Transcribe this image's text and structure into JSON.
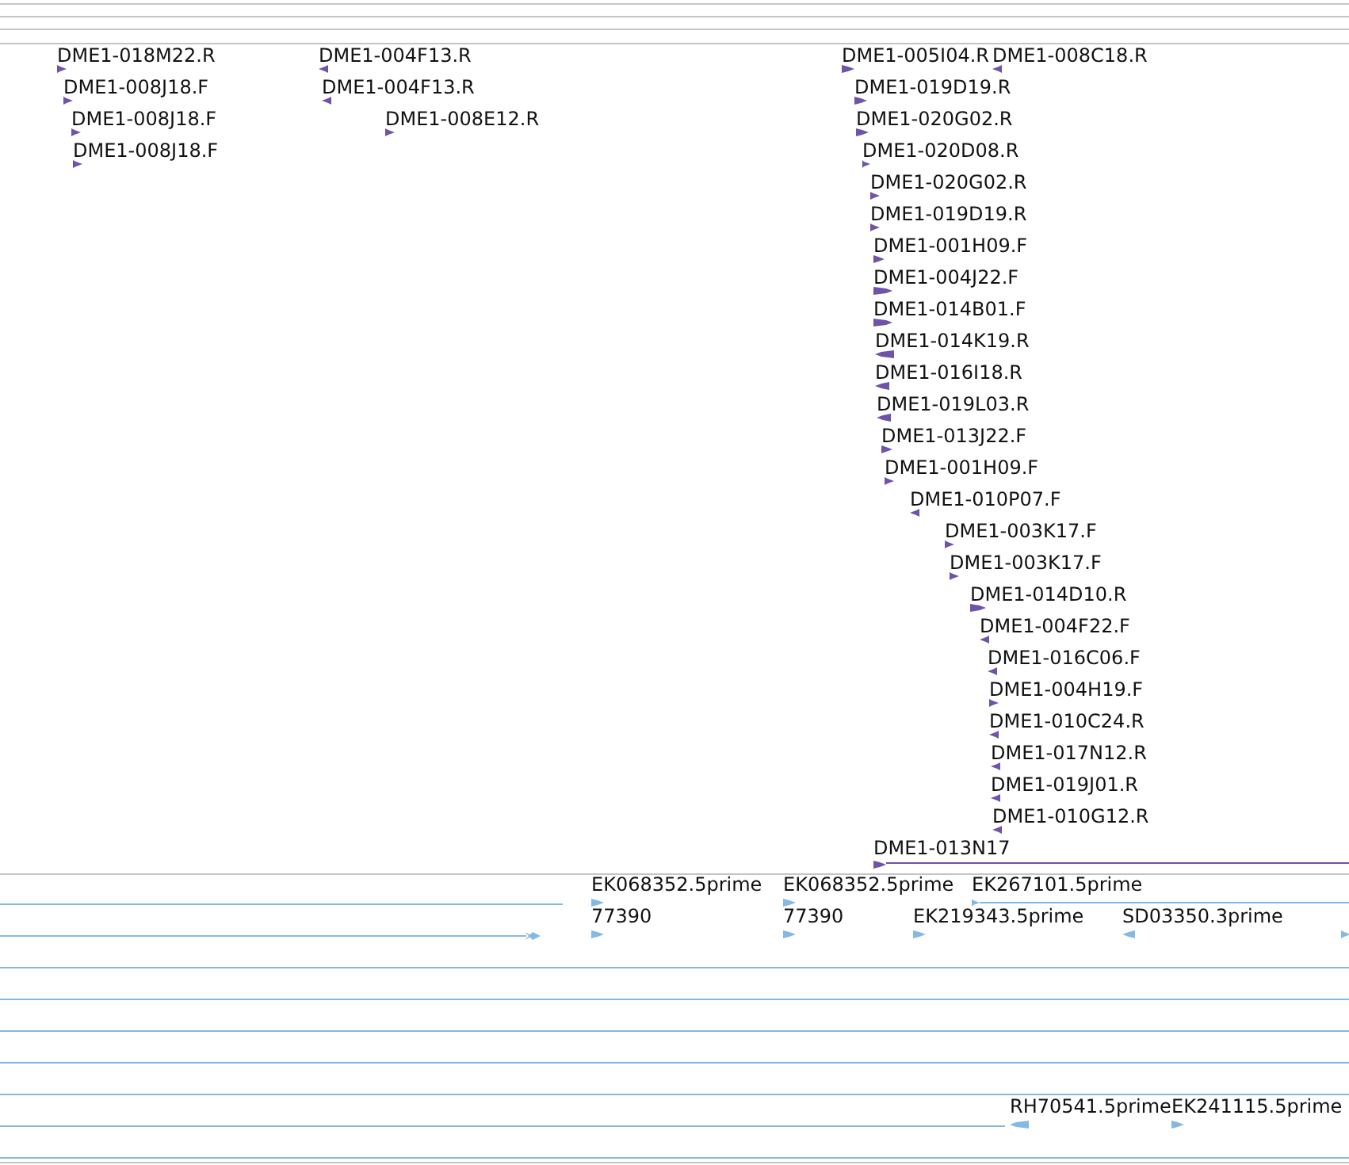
{
  "tracks": [
    {
      "kind": "clones",
      "features": [
        {
          "label": "DME1-018M22.R",
          "kind": "forward"
        },
        {
          "label": "DME1-008J18.F",
          "kind": "forward"
        },
        {
          "label": "DME1-008J18.F",
          "kind": "forward"
        },
        {
          "label": "DME1-008J18.F",
          "kind": "forward"
        },
        {
          "label": "DME1-004F13.R",
          "kind": "reverse"
        },
        {
          "label": "DME1-004F13.R",
          "kind": "reverse"
        },
        {
          "label": "DME1-008E12.R",
          "kind": "forward"
        },
        {
          "label": "DME1-005I04.R",
          "kind": "forward"
        },
        {
          "label": "DME1-008C18.R",
          "kind": "reverse"
        },
        {
          "label": "DME1-019D19.R",
          "kind": "forward"
        },
        {
          "label": "DME1-020G02.R",
          "kind": "forward"
        },
        {
          "label": "DME1-020D08.R",
          "kind": "forward"
        },
        {
          "label": "DME1-020G02.R",
          "kind": "forward"
        },
        {
          "label": "DME1-019D19.R",
          "kind": "forward"
        },
        {
          "label": "DME1-001H09.F",
          "kind": "forward"
        },
        {
          "label": "DME1-004J22.F",
          "kind": "forward"
        },
        {
          "label": "DME1-014B01.F",
          "kind": "forward"
        },
        {
          "label": "DME1-014K19.R",
          "kind": "reverse"
        },
        {
          "label": "DME1-016I18.R",
          "kind": "reverse"
        },
        {
          "label": "DME1-019L03.R",
          "kind": "reverse"
        },
        {
          "label": "DME1-013J22.F",
          "kind": "forward"
        },
        {
          "label": "DME1-001H09.F",
          "kind": "forward"
        },
        {
          "label": "DME1-010P07.F",
          "kind": "reverse"
        },
        {
          "label": "DME1-003K17.F",
          "kind": "forward"
        },
        {
          "label": "DME1-003K17.F",
          "kind": "forward"
        },
        {
          "label": "DME1-014D10.R",
          "kind": "forward"
        },
        {
          "label": "DME1-004F22.F",
          "kind": "reverse"
        },
        {
          "label": "DME1-016C06.F",
          "kind": "reverse"
        },
        {
          "label": "DME1-004H19.F",
          "kind": "forward"
        },
        {
          "label": "DME1-010C24.R",
          "kind": "reverse"
        },
        {
          "label": "DME1-017N12.R",
          "kind": "reverse"
        },
        {
          "label": "DME1-019J01.R",
          "kind": "reverse"
        },
        {
          "label": "DME1-010G12.R",
          "kind": "reverse"
        },
        {
          "label": "DME1-013N17",
          "kind": "forward"
        }
      ]
    },
    {
      "kind": "ests",
      "features": [
        {
          "label": "EK068352.5prime",
          "kind": "forward"
        },
        {
          "label": "EK068352.5prime",
          "kind": "forward"
        },
        {
          "label": "EK267101.5prime",
          "kind": "forward"
        },
        {
          "label": "77390",
          "kind": "forward"
        },
        {
          "label": "77390",
          "kind": "forward"
        },
        {
          "label": "EK219343.5prime",
          "kind": "forward"
        },
        {
          "label": "SD03350.3prime",
          "kind": "reverse"
        },
        {
          "kind": "forward"
        },
        {
          "label": "RH70541.5prime",
          "kind": "reverse"
        },
        {
          "label": "EK241115.5prime",
          "kind": "forward"
        }
      ]
    }
  ]
}
